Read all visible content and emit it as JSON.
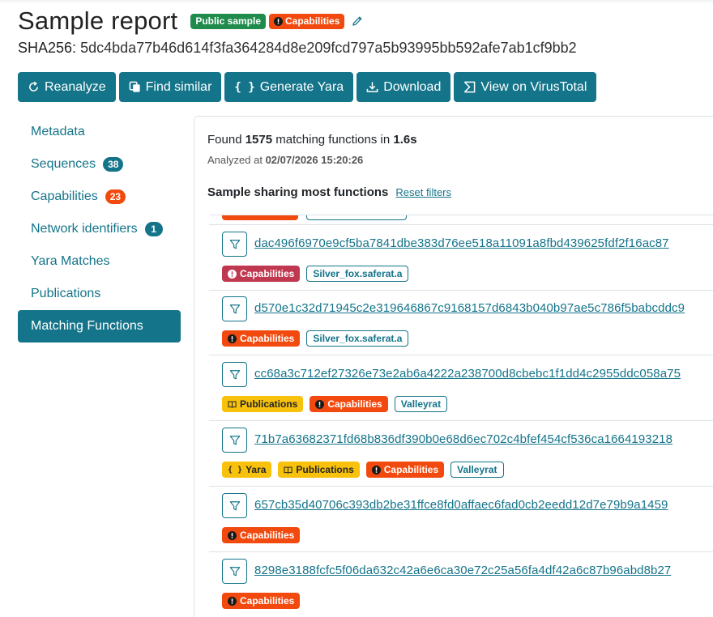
{
  "header": {
    "title": "Sample report",
    "badges": {
      "public": "Public sample",
      "capabilities": "Capabilities"
    },
    "sha_label": "SHA256:",
    "sha_value": "5dc4bda77b46d614f3fa364284d8e209fcd797a5b93995bb592afe7ab1cf9bb2"
  },
  "actions": {
    "reanalyze": "Reanalyze",
    "find_similar": "Find similar",
    "generate_yara": "Generate Yara",
    "download": "Download",
    "virustotal": "View on VirusTotal"
  },
  "sidebar": {
    "items": [
      {
        "label": "Metadata"
      },
      {
        "label": "Sequences",
        "count": "38"
      },
      {
        "label": "Capabilities",
        "count": "23"
      },
      {
        "label": "Network identifiers",
        "count": "1"
      },
      {
        "label": "Yara Matches"
      },
      {
        "label": "Publications"
      },
      {
        "label": "Matching Functions",
        "active": true
      }
    ]
  },
  "main": {
    "found_prefix": "Found",
    "found_count": "1575",
    "found_mid": "matching functions in",
    "found_time": "1.6s",
    "analyzed_prefix": "Analyzed at",
    "analyzed_time": "02/07/2026 15:20:26",
    "sharing_title": "Sample sharing most functions",
    "reset_filters": "Reset filters"
  },
  "samples": [
    {
      "hash": "dac496f6970e9cf5ba7841dbe383d76ee518a11091a8fbd439625fdf2f16ac87",
      "tags": [
        "Capabilities",
        "Silver_fox.saferat.a"
      ]
    },
    {
      "hash": "d570e1c32d71945c2e319646867c9168157d6843b040b97ae5c786f5babcddc9",
      "tags": [
        "Capabilities",
        "Silver_fox.saferat.a"
      ]
    },
    {
      "hash": "cc68a3c712ef27326e73e2ab6a4222a238700d8cbebc1f1dd4c2955ddc058a75",
      "tags": [
        "Publications",
        "Capabilities",
        "Valleyrat"
      ]
    },
    {
      "hash": "71b7a63682371fd68b836df390b0e68d6ec702c4bfef454cf536ca1664193218",
      "tags": [
        "Yara",
        "Publications",
        "Capabilities",
        "Valleyrat"
      ]
    },
    {
      "hash": "657cb35d40706c393db2be31ffce8fd0affaec6fad0cb2eedd12d7e79b9a1459",
      "tags": [
        "Capabilities"
      ]
    },
    {
      "hash": "8298e3188fcfc5f06da632c42a6e6ca30e72c25a56fa4df42a6c87b96abd8b27",
      "tags": [
        "Capabilities"
      ]
    }
  ],
  "colors": {
    "primary": "#14748a",
    "capabilities": "#f24a0e",
    "capabilities_alt": "#c0384f",
    "public": "#1f8b4c",
    "publication": "#f8c10b"
  }
}
